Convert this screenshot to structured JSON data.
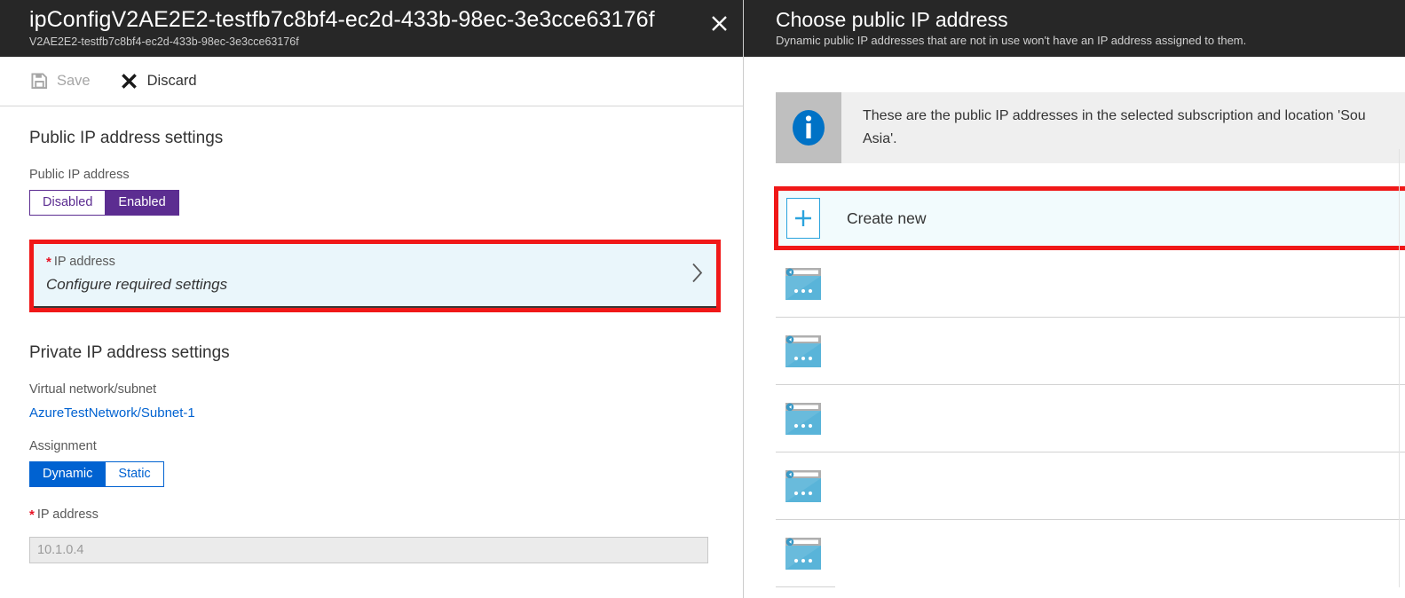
{
  "left_blade": {
    "title": "ipConfigV2AE2E2-testfb7c8bf4-ec2d-433b-98ec-3e3cce63176f",
    "subtitle": "V2AE2E2-testfb7c8bf4-ec2d-433b-98ec-3e3cce63176f",
    "close_icon": "close-icon",
    "toolbar": {
      "save_label": "Save",
      "save_icon": "save-floppy-icon",
      "save_enabled": false,
      "discard_label": "Discard",
      "discard_icon": "discard-x-icon",
      "discard_enabled": true
    },
    "public_section": {
      "heading": "Public IP address settings",
      "toggle_label": "Public IP address",
      "options": [
        "Disabled",
        "Enabled"
      ],
      "selected": "Enabled",
      "accent_color": "#5c2d91"
    },
    "ip_selector": {
      "required_marker": "*",
      "label": "IP address",
      "value": "Configure required settings",
      "chevron_icon": "chevron-right-icon",
      "highlight_color": "#f01818"
    },
    "private_section": {
      "heading": "Private IP address settings",
      "vnet_label": "Virtual network/subnet",
      "vnet_value": "AzureTestNetwork/Subnet-1",
      "assignment_label": "Assignment",
      "assignment_options": [
        "Dynamic",
        "Static"
      ],
      "assignment_selected": "Dynamic",
      "accent_color": "#0062d1",
      "ip_required_marker": "*",
      "ip_label": "IP address",
      "ip_value": "10.1.0.4"
    }
  },
  "right_blade": {
    "title": "Choose public IP address",
    "subtitle": "Dynamic public IP addresses that are not in use won't have an IP address assigned to them.",
    "info": {
      "icon": "info-circle-icon",
      "text": "These are the public IP addresses in the selected subscription and location 'Sou\nAsia'."
    },
    "create_new": {
      "label": "Create new",
      "icon": "plus-icon",
      "highlight_color": "#f01818"
    },
    "ip_list": [
      {
        "icon": "public-ip-address-icon",
        "label": ""
      },
      {
        "icon": "public-ip-address-icon",
        "label": ""
      },
      {
        "icon": "public-ip-address-icon",
        "label": ""
      },
      {
        "icon": "public-ip-address-icon",
        "label": ""
      },
      {
        "icon": "public-ip-address-icon",
        "label": ""
      }
    ]
  }
}
